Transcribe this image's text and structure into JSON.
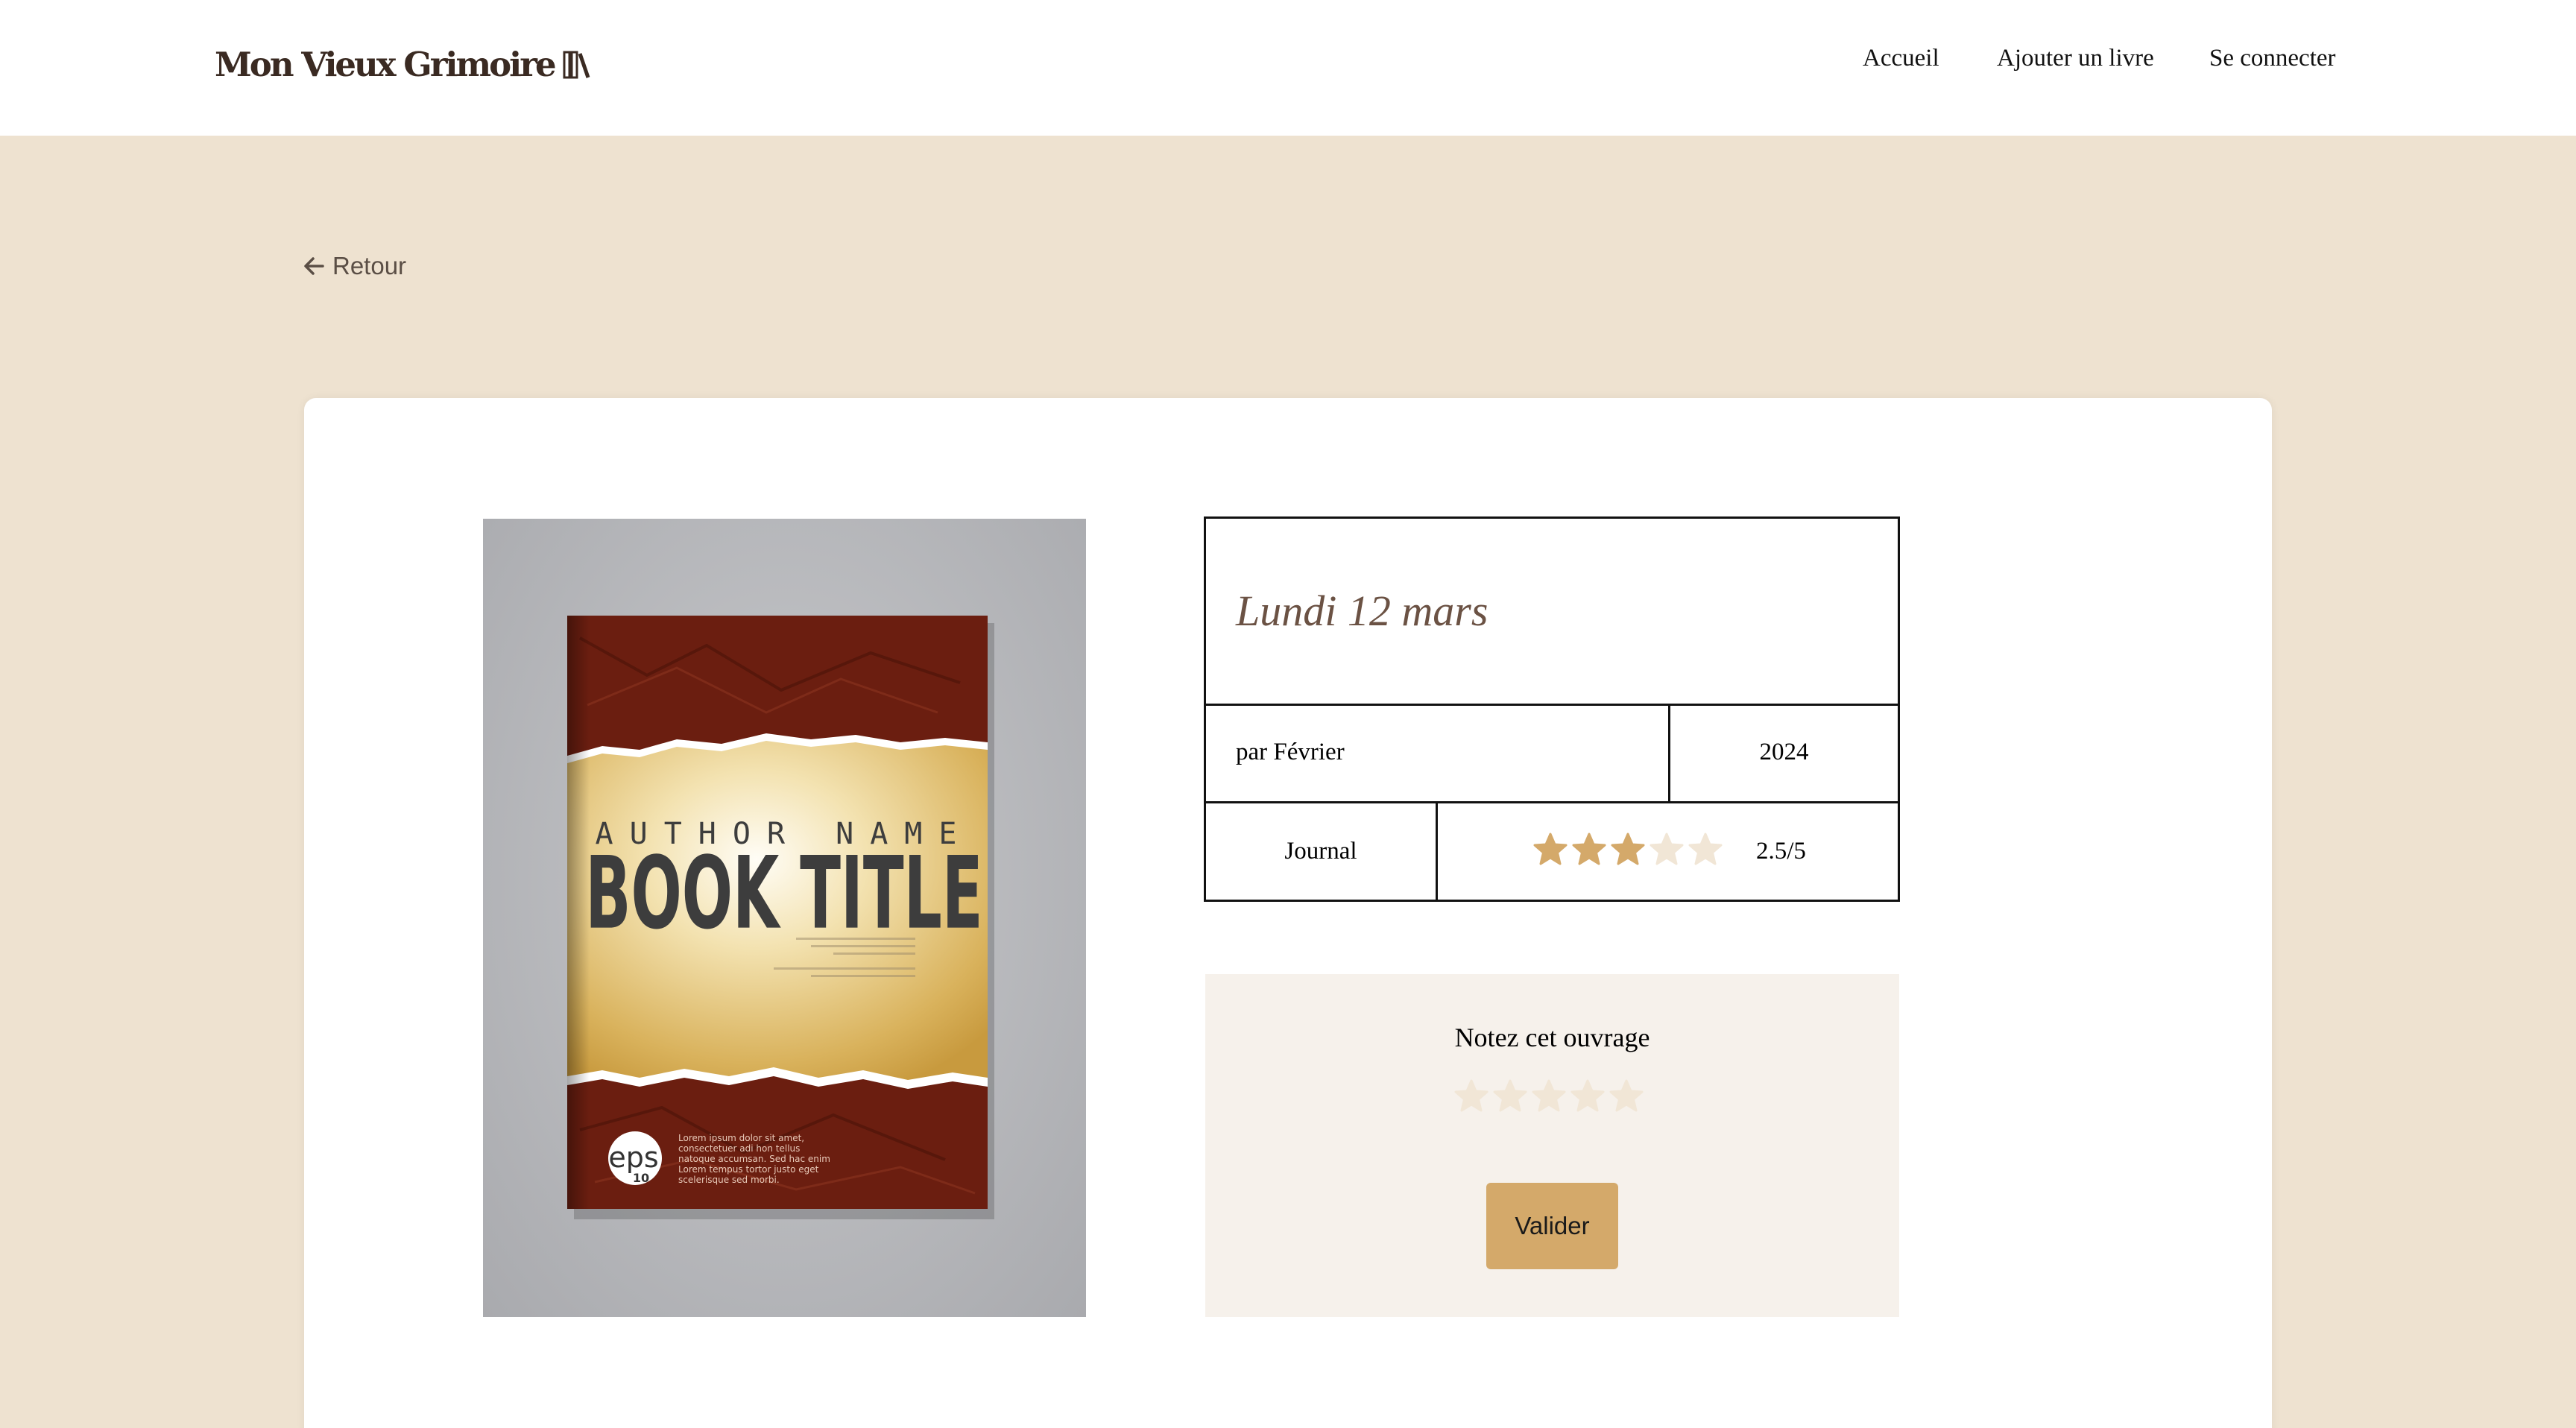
{
  "header": {
    "logo_text": "Mon Vieux Grimoire",
    "logo_icon": "books-icon",
    "nav": [
      "Accueil",
      "Ajouter un livre",
      "Se connecter"
    ]
  },
  "back": {
    "label": "Retour",
    "icon": "arrow-left-icon"
  },
  "book": {
    "title": "Lundi 12 mars",
    "author": "par Février",
    "year": "2024",
    "genre": "Journal",
    "average_rating": 2.5,
    "average_label": "2.5/5",
    "cover": {
      "author_name": "AUTHOR NAME",
      "title": "BOOK TITLE",
      "badge": "eps",
      "badge_sub": "10",
      "blurb": [
        "Lorem ipsum dolor sit amet,",
        "consectetuer adi hon tellus",
        "natoque accumsan. Sed hac enim",
        "Lorem tempus tortor justo eget",
        "scelerisque sed morbi."
      ]
    }
  },
  "rating_form": {
    "title": "Notez cet ouvrage",
    "submit_label": "Valider",
    "selected": 0
  },
  "colors": {
    "page_bg": "#EEE2D0",
    "star_filled": "#D4A96A",
    "star_empty": "#F1E6D6",
    "button": "#D4A96A",
    "title_text": "#6B5244"
  }
}
